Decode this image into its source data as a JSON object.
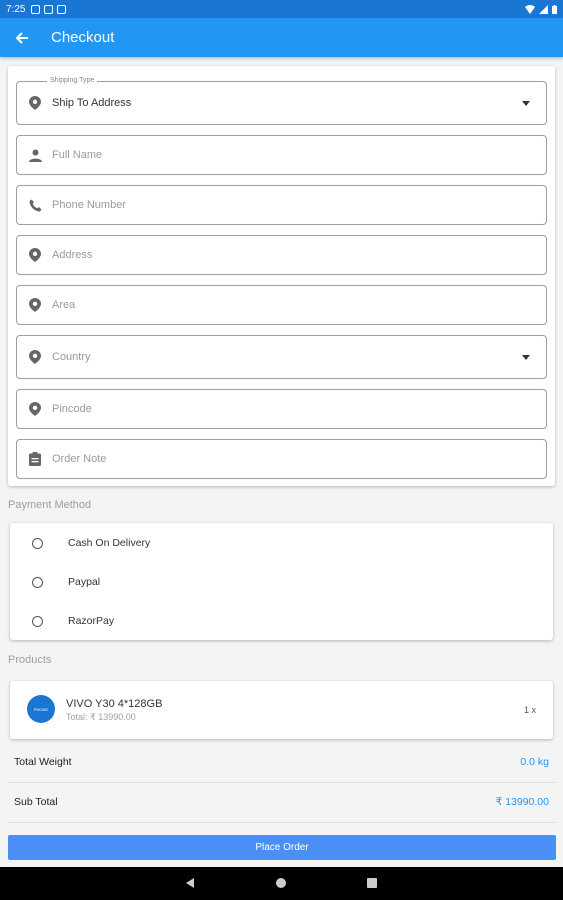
{
  "status_bar": {
    "time": "7:25"
  },
  "app_bar": {
    "title": "Checkout"
  },
  "shipping": {
    "legend": "Shipping Type",
    "type_value": "Ship To Address",
    "full_name_placeholder": "Full Name",
    "phone_placeholder": "Phone Number",
    "address_placeholder": "Address",
    "area_placeholder": "Area",
    "country_placeholder": "Country",
    "pincode_placeholder": "Pincode",
    "order_note_placeholder": "Order Note"
  },
  "payment": {
    "title": "Payment Method",
    "options": [
      "Cash On Delivery",
      "Paypal",
      "RazorPay"
    ]
  },
  "products": {
    "title": "Products",
    "items": [
      {
        "name": "VIVO Y30 4*128GB",
        "total": "Total: ₹ 13990.00",
        "qty": "1 x",
        "thumb_text": "PHONE"
      }
    ]
  },
  "summary": {
    "total_weight_label": "Total Weight",
    "total_weight_value": "0.0 kg",
    "sub_total_label": "Sub Total",
    "sub_total_value": "₹ 13990.00"
  },
  "actions": {
    "place_order_label": "Place Order"
  },
  "colors": {
    "primary": "#2196f3",
    "status_bar": "#1976d2",
    "button": "#4a8ff5"
  },
  "icons": [
    "back-arrow-icon",
    "location-pin-icon",
    "person-icon",
    "phone-icon",
    "clipboard-icon",
    "dropdown-caret-icon"
  ]
}
